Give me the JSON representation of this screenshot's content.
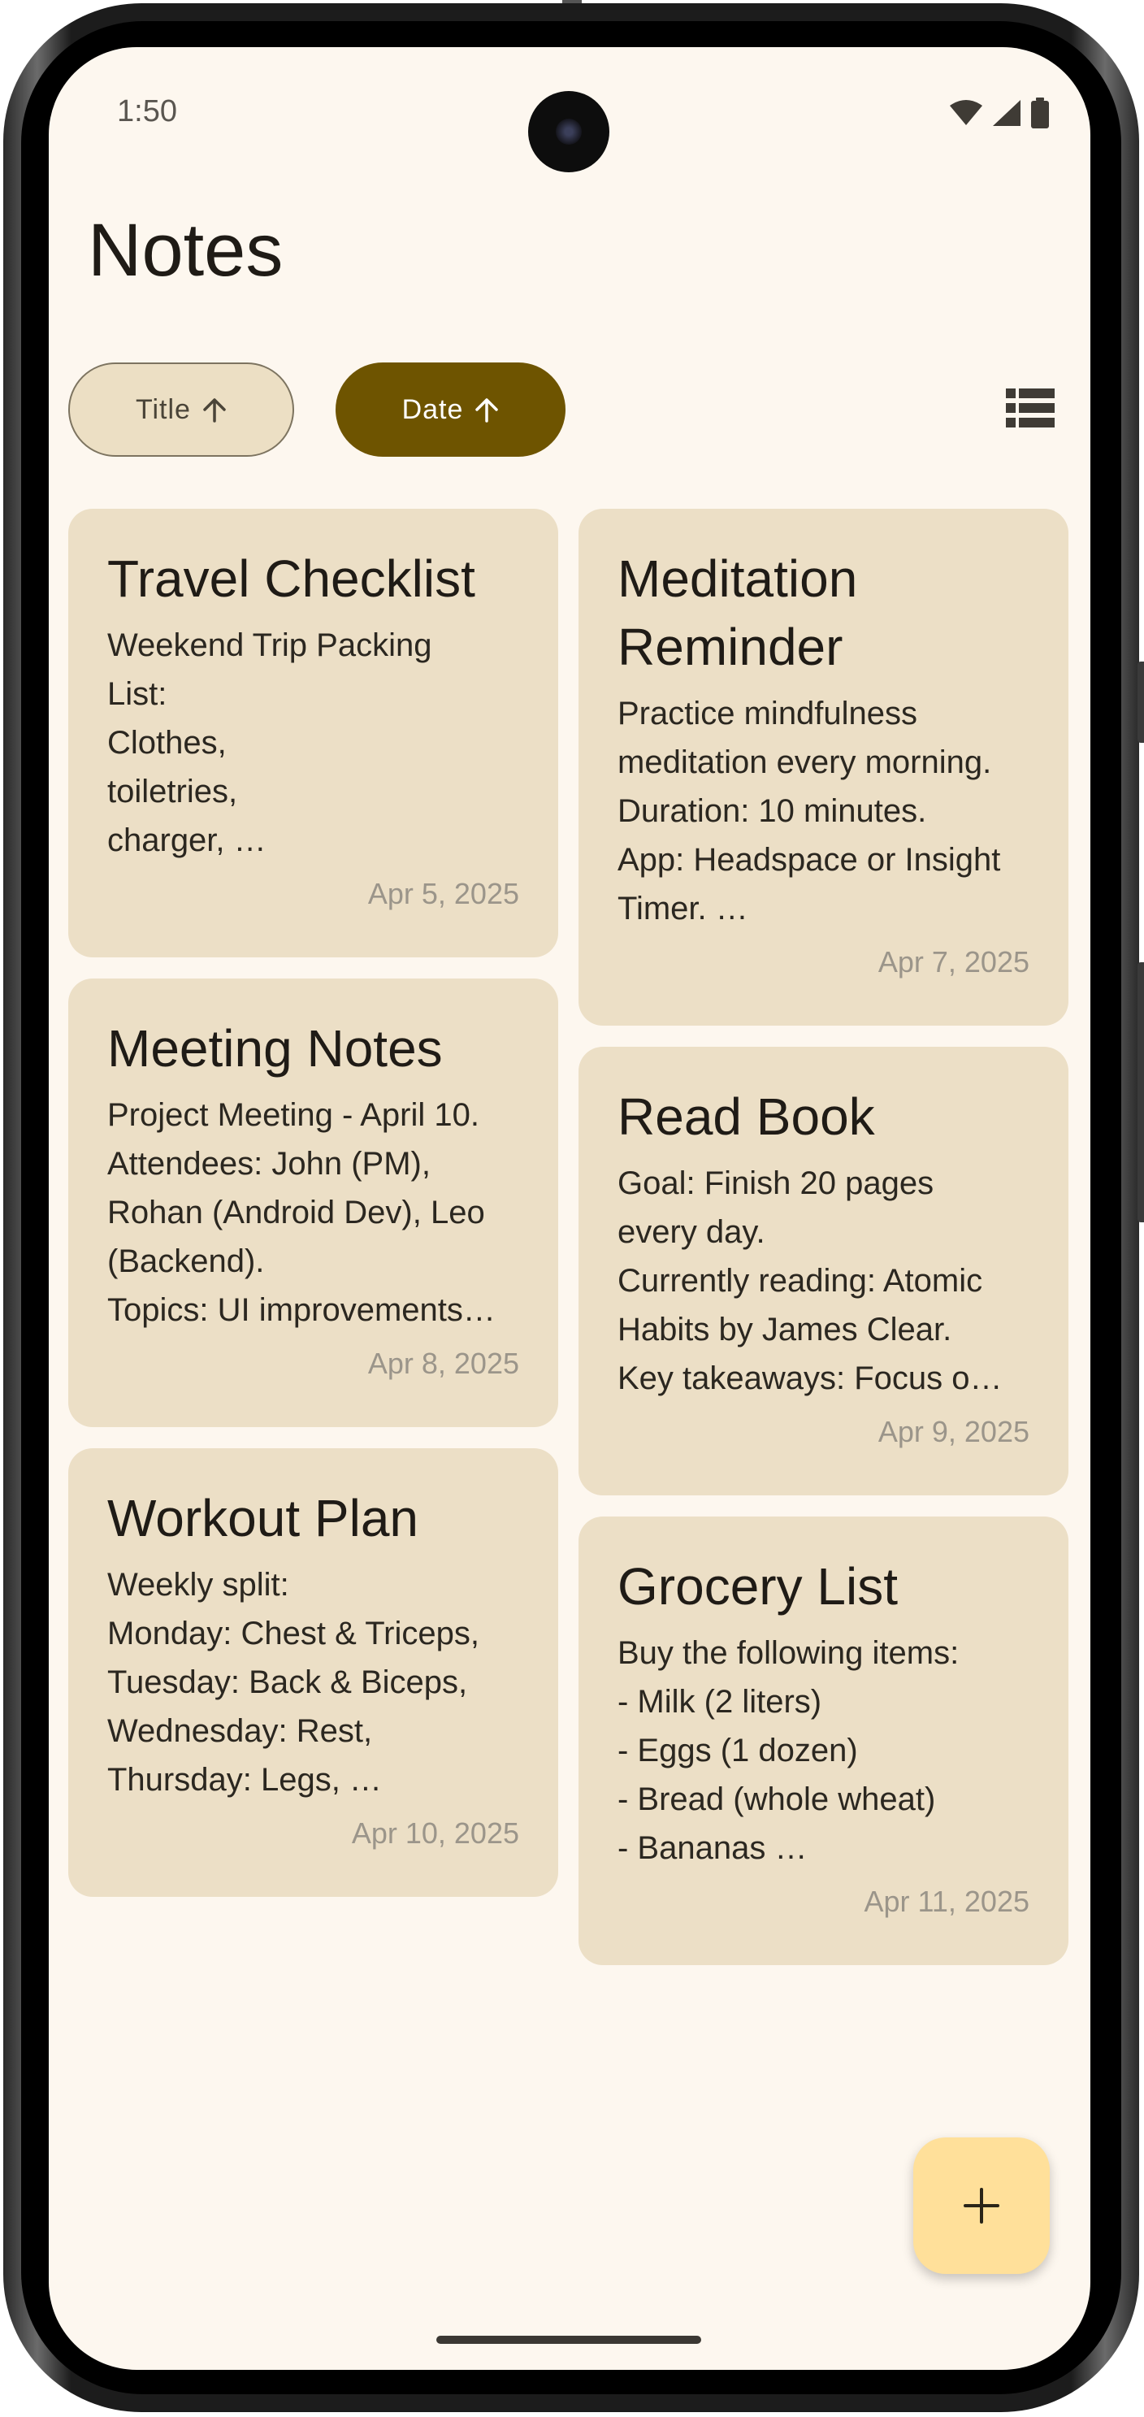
{
  "status_bar": {
    "time": "1:50",
    "icons": [
      "wifi-icon",
      "signal-icon",
      "battery-icon"
    ]
  },
  "header": {
    "title": "Notes"
  },
  "sort_chips": {
    "title_label": "Title",
    "title_icon": "arrow-up-icon",
    "date_label": "Date",
    "date_icon": "arrow-up-icon",
    "active": "Date"
  },
  "layout_toggle": {
    "icon": "list-view-icon"
  },
  "notes": {
    "left": [
      {
        "title": "Travel Checklist",
        "body": "Weekend Trip Packing\nList:\nClothes,\ntoiletries,\ncharger, …",
        "date": "Apr 5, 2025"
      },
      {
        "title": "Meeting Notes",
        "body": "Project Meeting - April 10.\nAttendees: John (PM),\nRohan (Android Dev), Leo\n(Backend).\nTopics: UI improvements…",
        "date": "Apr 8, 2025"
      },
      {
        "title": "Workout Plan",
        "body": "Weekly split:\nMonday: Chest & Triceps,\nTuesday: Back & Biceps,\nWednesday: Rest,\nThursday: Legs, …",
        "date": "Apr 10, 2025"
      }
    ],
    "right": [
      {
        "title": "Meditation\nReminder",
        "body": "Practice mindfulness\nmeditation every morning.\nDuration: 10 minutes.\nApp: Headspace or Insight\nTimer. …",
        "date": "Apr 7, 2025"
      },
      {
        "title": "Read Book",
        "body": "Goal: Finish 20 pages\nevery day.\nCurrently reading: Atomic\nHabits by James Clear.\nKey takeaways: Focus o…",
        "date": "Apr 9, 2025"
      },
      {
        "title": "Grocery List",
        "body": "Buy the following items:\n - Milk (2 liters)\n- Eggs (1 dozen)\n- Bread (whole wheat)\n- Bananas …",
        "date": "Apr 11, 2025"
      }
    ]
  },
  "fab": {
    "icon": "plus-icon"
  },
  "colors": {
    "background": "#fdf7ef",
    "card": "#ecdfc6",
    "active_chip": "#6e5400",
    "inactive_chip": "#ecdfc4",
    "fab": "#ffe09a"
  }
}
